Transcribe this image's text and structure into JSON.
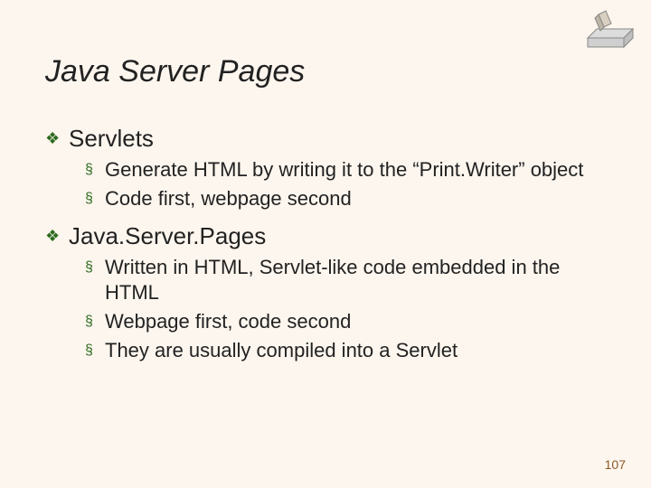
{
  "title": "Java Server Pages",
  "sections": [
    {
      "heading": "Servlets",
      "items": [
        "Generate HTML by writing it to the “Print.Writer” object",
        "Code first, webpage second"
      ]
    },
    {
      "heading": "Java.Server.Pages",
      "items": [
        "Written in HTML, Servlet-like code embedded in the HTML",
        "Webpage first, code second",
        "They are usually compiled into a Servlet"
      ]
    }
  ],
  "page_number": "107",
  "glyphs": {
    "diamond": "❖",
    "square": "§"
  }
}
